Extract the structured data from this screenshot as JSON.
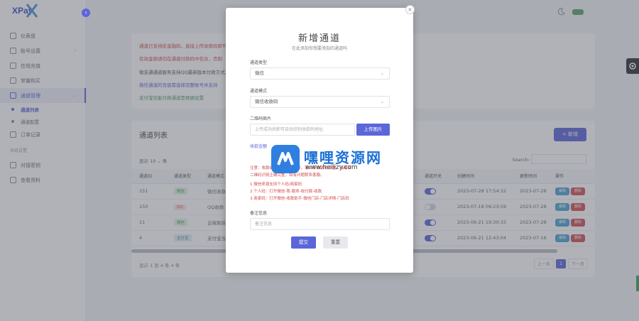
{
  "app": {
    "logo": "XPay"
  },
  "sidebar": {
    "items": [
      {
        "label": "仪表盘",
        "icon": "dashboard-icon"
      },
      {
        "label": "账号设置",
        "icon": "book-icon",
        "arrow": "›"
      },
      {
        "label": "在线充值",
        "icon": "cash-icon"
      },
      {
        "label": "常量购买",
        "icon": "doc-icon"
      },
      {
        "label": "通道管理",
        "icon": "gear-icon",
        "arrow": "⌄",
        "active": true
      }
    ],
    "sub_items": [
      {
        "label": "通道列表",
        "active": true
      },
      {
        "label": "通道配置",
        "active": false
      }
    ],
    "order_item": {
      "label": "订单记录",
      "icon": "list-icon"
    },
    "section": "系统设置",
    "extra_items": [
      {
        "label": "对接密钥",
        "icon": "key-icon"
      },
      {
        "label": "查看资料",
        "icon": "link-icon"
      }
    ]
  },
  "notice": {
    "lines": [
      {
        "text": "通道已支持反金融码，直接上传收款码即可",
        "color": "#d24a4a"
      },
      {
        "text": "有效金额请勿在通道付款码中包含，否则",
        "color": "#d24a4a"
      },
      {
        "text": "微支通通道服务支持QQ最新版本付款方式及微",
        "color": "#555555"
      },
      {
        "text": "微信通道的充值需选择完整账号并支持",
        "color": "#5b67d8"
      },
      {
        "text": "支付宝仅能付款通道是根据设置",
        "color": "#4c9a5c"
      }
    ]
  },
  "list": {
    "title": "通道列表",
    "add_label": "+ 新增",
    "show_label": "显示 10 ⌄ 条",
    "search_label": "Search:",
    "columns": [
      "通道ID",
      "通道类型",
      "通道模式",
      "",
      "",
      "",
      "",
      "",
      "",
      "通道开关",
      "创建时间",
      "更新时间",
      "操作"
    ],
    "rows": [
      {
        "id": "151",
        "type": "微信",
        "type_color": "green",
        "mode": "微信收款码",
        "switch": true,
        "created": "2023-07-28 17:54:32",
        "updated": "2023-07-28"
      },
      {
        "id": "150",
        "type": "QQ",
        "type_color": "red",
        "mode": "QQ收款 不",
        "switch": false,
        "created": "2023-07-18 09:23:59",
        "updated": "2023-07-28"
      },
      {
        "id": "11",
        "type": "微信",
        "type_color": "green",
        "mode": "云端免挂 A",
        "switch": true,
        "created": "2023-06-21 19:30:33",
        "updated": "2023-07-28"
      },
      {
        "id": "4",
        "type": "支付宝",
        "type_color": "teal",
        "mode": "支付宝当面",
        "switch": true,
        "created": "2023-06-21 12:43:04",
        "updated": "2023-07-16"
      }
    ],
    "edit_label": "编辑",
    "delete_label": "删除",
    "footer": "显示 1 到 4 条 4 条",
    "pager": {
      "prev": "上一页",
      "current": "1",
      "next": "下一页"
    }
  },
  "modal": {
    "title": "新增通道",
    "subtitle": "在此添加你想要添加的通道吗",
    "fields": {
      "channel_type_label": "通道类型",
      "channel_type_value": "微信",
      "channel_mode_label": "通道模式",
      "channel_mode_value": "微信收款码",
      "qrcode_label": "二维码图片",
      "qrcode_placeholder": "上传成功后即可自动识别收款码地址",
      "upload_label": "上传图片",
      "remark_label": "备注信息",
      "remark_placeholder": "备注信息"
    },
    "hint_title": "收款金额",
    "hints": [
      {
        "text": "注意：收款码不要带固定金额，请上传收款码原图，请确保",
        "color": "#d24a4a"
      },
      {
        "text": "二维码识别正确完整，如有问题联系客服。",
        "color": "#d24a4a"
      },
      {
        "text": "1.微信来源支持个人码/商家码",
        "color": "#d24a4a"
      },
      {
        "text": "2.个人码：打开微信-我-服务-收付款-收款",
        "color": "#d24a4a"
      },
      {
        "text": "3.商家码：打开微信-收款助手-微信门店-门店详情-门店码",
        "color": "#d24a4a"
      }
    ],
    "submit_label": "提交",
    "reset_label": "重置",
    "close_label": "×"
  },
  "watermark": {
    "text": "嘿哩资源网",
    "url": "www.heilizy.com"
  }
}
